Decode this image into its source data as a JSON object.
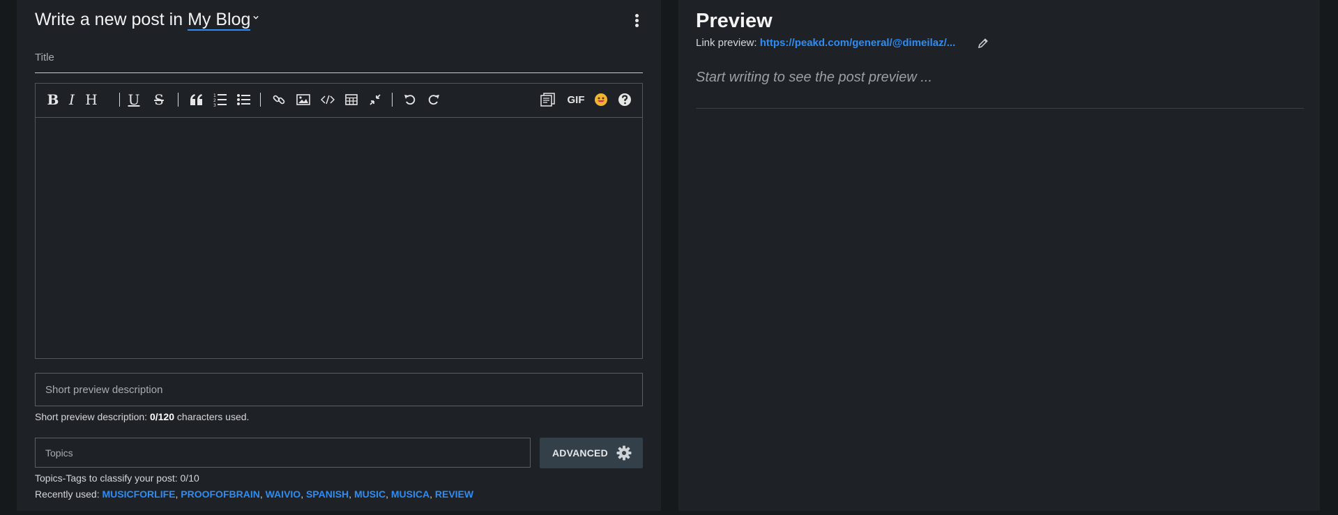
{
  "composer": {
    "heading_prefix": "Write a new post in",
    "blog_name": "My Blog",
    "title_placeholder": "Title",
    "description_placeholder": "Short preview description",
    "description_note_prefix": "Short preview description:",
    "description_count": "0/120",
    "description_note_suffix": "characters used.",
    "topics_placeholder": "Topics",
    "advanced_label": "ADVANCED",
    "tags_note": "Topics-Tags to classify your post: 0/10",
    "recent_label": "Recently used:",
    "recent_tags": [
      "MUSICFORLIFE",
      "PROOFOFBRAIN",
      "WAIVIO",
      "SPANISH",
      "MUSIC",
      "MUSICA",
      "REVIEW"
    ]
  },
  "toolbar": {
    "bold": "B",
    "italic": "I",
    "heading": "H",
    "underline": "U",
    "strike": "S",
    "gif": "GIF",
    "icons": [
      "bold",
      "italic",
      "heading",
      "underline",
      "strikethrough",
      "quote",
      "ordered-list",
      "unordered-list",
      "link",
      "image",
      "code",
      "table",
      "collapse",
      "undo",
      "redo",
      "templates",
      "gif",
      "emoji",
      "help"
    ]
  },
  "preview": {
    "title": "Preview",
    "link_label": "Link preview:",
    "link_url": "https://peakd.com/general/@dimeilaz/...",
    "placeholder": "Start writing to see the post preview ..."
  },
  "colors": {
    "background": "#16191c",
    "panel": "#1e2226",
    "accent": "#2f8cf3",
    "advanced_button": "#33404a"
  }
}
